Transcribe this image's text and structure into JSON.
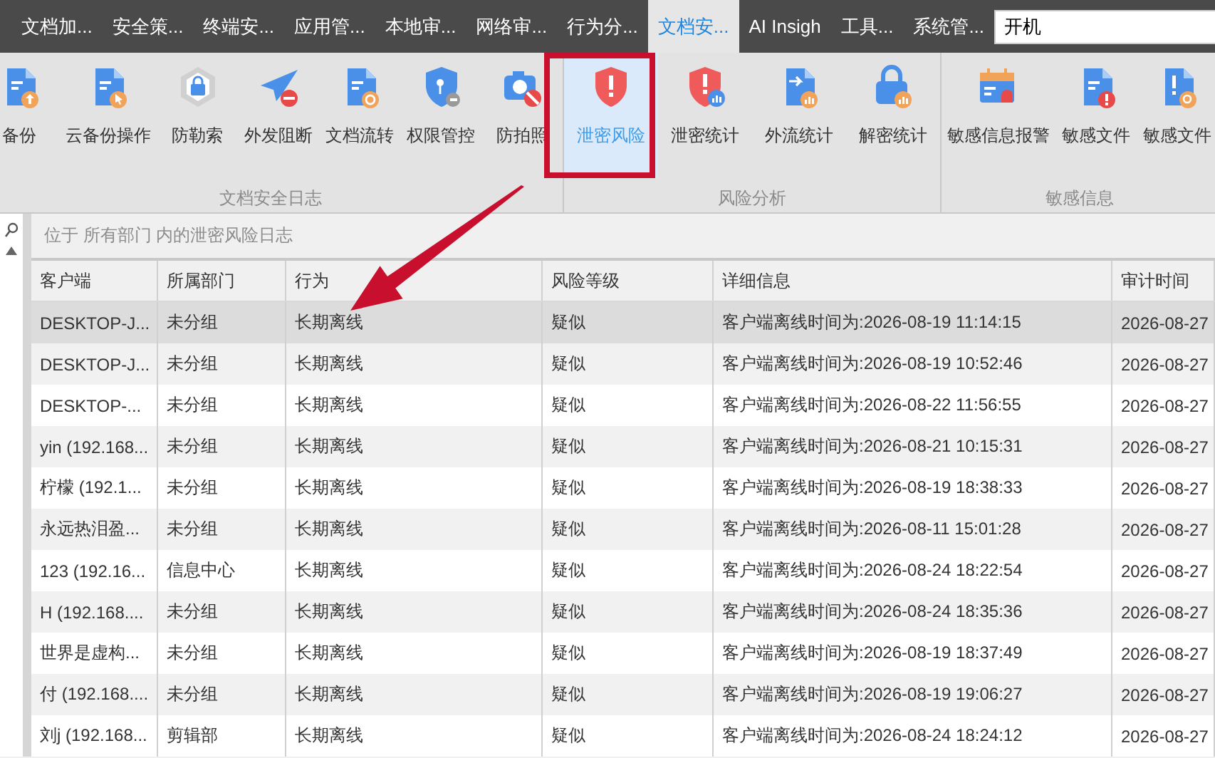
{
  "menu_tabs": [
    {
      "label": "文档加...",
      "selected": false
    },
    {
      "label": "安全策...",
      "selected": false
    },
    {
      "label": "终端安...",
      "selected": false
    },
    {
      "label": "应用管...",
      "selected": false
    },
    {
      "label": "本地审...",
      "selected": false
    },
    {
      "label": "网络审...",
      "selected": false
    },
    {
      "label": "行为分...",
      "selected": false
    },
    {
      "label": "文档安...",
      "selected": true
    },
    {
      "label": "AI Insigh",
      "selected": false
    },
    {
      "label": "工具...",
      "selected": false
    },
    {
      "label": "系统管...",
      "selected": false
    }
  ],
  "search": {
    "value": "开机"
  },
  "ribbon_groups": [
    {
      "title": "文档安全日志",
      "buttons": [
        {
          "label": "备份",
          "kind": "doc-upload",
          "selected": false
        },
        {
          "label": "云备份操作",
          "kind": "doc-cursor",
          "selected": false
        },
        {
          "label": "防勒索",
          "kind": "hex-lock",
          "selected": false
        },
        {
          "label": "外发阻断",
          "kind": "plane",
          "selected": false
        },
        {
          "label": "文档流转",
          "kind": "doc-cycle",
          "selected": false
        },
        {
          "label": "权限管控",
          "kind": "shield-key",
          "selected": false
        },
        {
          "label": "防拍照",
          "kind": "camera",
          "selected": false
        }
      ]
    },
    {
      "title": "风险分析",
      "buttons": [
        {
          "label": "泄密风险",
          "kind": "shield-alert",
          "selected": true
        },
        {
          "label": "泄密统计",
          "kind": "shield-chart",
          "selected": false
        },
        {
          "label": "外流统计",
          "kind": "doc-arrow",
          "selected": false
        },
        {
          "label": "解密统计",
          "kind": "lock-chart",
          "selected": false
        }
      ]
    },
    {
      "title": "敏感信息",
      "buttons": [
        {
          "label": "敏感信息报警",
          "kind": "calendar-alarm",
          "selected": false
        },
        {
          "label": "敏感文件",
          "kind": "doc-alert",
          "selected": false
        },
        {
          "label": "敏感文件",
          "kind": "doc-search",
          "selected": false
        }
      ]
    }
  ],
  "location_text": "位于 所有部门 内的泄密风险日志",
  "table": {
    "columns": [
      "客户端",
      "所属部门",
      "行为",
      "风险等级",
      "详细信息",
      "审计时间"
    ],
    "rows": [
      {
        "cells": [
          "DESKTOP-J...",
          "未分组",
          "长期离线",
          "疑似",
          "客户端离线时间为:2026-08-19 11:14:15",
          "2026-08-27"
        ],
        "selected": true
      },
      {
        "cells": [
          "DESKTOP-J...",
          "未分组",
          "长期离线",
          "疑似",
          "客户端离线时间为:2026-08-19 10:52:46",
          "2026-08-27"
        ],
        "selected": false
      },
      {
        "cells": [
          "DESKTOP-...",
          "未分组",
          "长期离线",
          "疑似",
          "客户端离线时间为:2026-08-22 11:56:55",
          "2026-08-27"
        ],
        "selected": false
      },
      {
        "cells": [
          "yin (192.168...",
          "未分组",
          "长期离线",
          "疑似",
          "客户端离线时间为:2026-08-21 10:15:31",
          "2026-08-27"
        ],
        "selected": false
      },
      {
        "cells": [
          "柠檬 (192.1...",
          "未分组",
          "长期离线",
          "疑似",
          "客户端离线时间为:2026-08-19 18:38:33",
          "2026-08-27"
        ],
        "selected": false
      },
      {
        "cells": [
          "永远热泪盈...",
          "未分组",
          "长期离线",
          "疑似",
          "客户端离线时间为:2026-08-11 15:01:28",
          "2026-08-27"
        ],
        "selected": false
      },
      {
        "cells": [
          "123 (192.16...",
          "信息中心",
          "长期离线",
          "疑似",
          "客户端离线时间为:2026-08-24 18:22:54",
          "2026-08-27"
        ],
        "selected": false
      },
      {
        "cells": [
          "H (192.168....",
          "未分组",
          "长期离线",
          "疑似",
          "客户端离线时间为:2026-08-24 18:35:36",
          "2026-08-27"
        ],
        "selected": false
      },
      {
        "cells": [
          "世界是虚构...",
          "未分组",
          "长期离线",
          "疑似",
          "客户端离线时间为:2026-08-19 18:37:49",
          "2026-08-27"
        ],
        "selected": false
      },
      {
        "cells": [
          "付 (192.168....",
          "未分组",
          "长期离线",
          "疑似",
          "客户端离线时间为:2026-08-19 19:06:27",
          "2026-08-27"
        ],
        "selected": false
      },
      {
        "cells": [
          "刘j (192.168...",
          "剪辑部",
          "长期离线",
          "疑似",
          "客户端离线时间为:2026-08-24 18:24:12",
          "2026-08-27"
        ],
        "selected": false
      }
    ]
  }
}
